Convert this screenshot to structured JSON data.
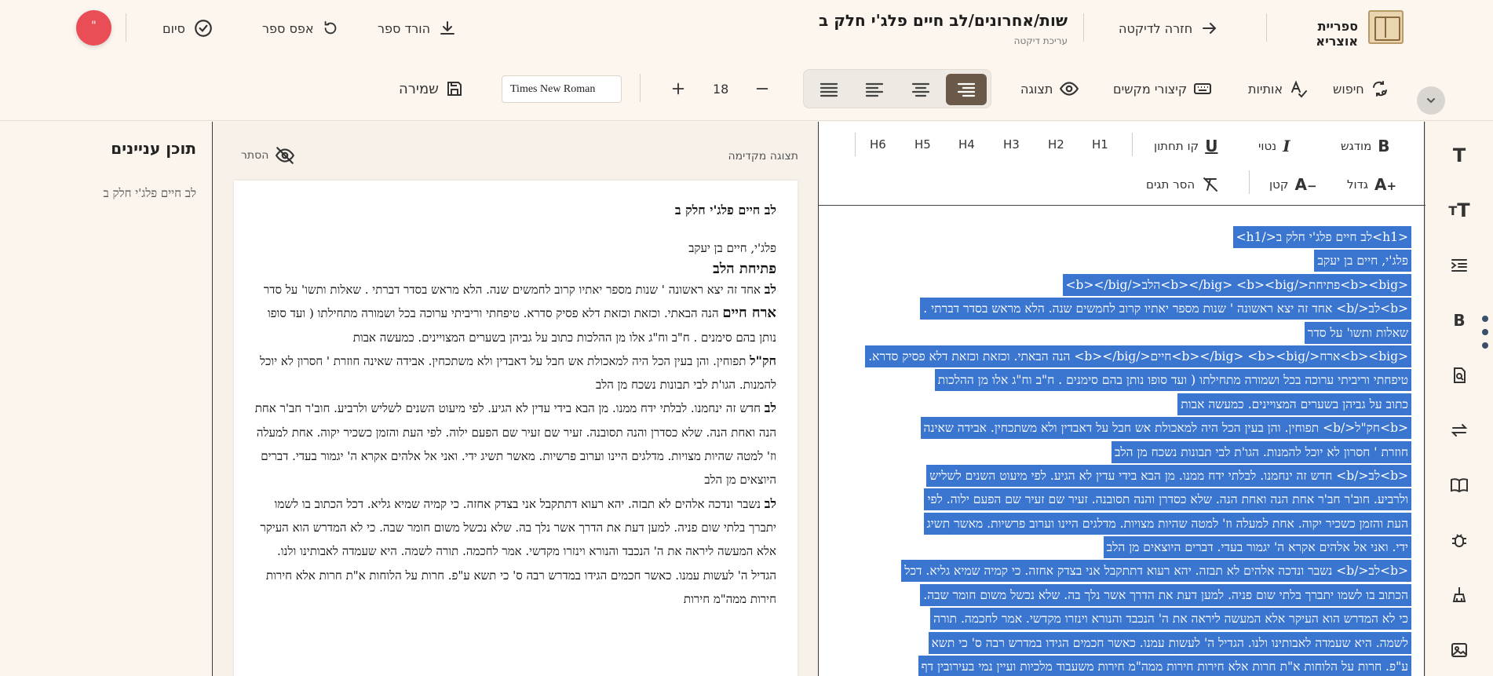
{
  "header": {
    "app_name": "ספריית אוצריא",
    "back_label": "חזרה לדיקטה",
    "title": "שות/אחרונים/לב חיים פלג'י חלק ב",
    "subtitle": "עריכת דיקטה",
    "download_label": "הורד ספר",
    "reset_label": "אפס ספר",
    "finish_label": "סיום",
    "avatar_text": "\""
  },
  "toolbar": {
    "search_label": "חיפוש",
    "letters_label": "אותיות",
    "shortcuts_label": "קיצורי מקשים",
    "view_label": "תצוגה",
    "font_size": "18",
    "font_family": "Times New Roman",
    "save_label": "שמירה"
  },
  "editor": {
    "bold_label": "מודגש",
    "italic_label": "נטוי",
    "underline_label": "קו תחתון",
    "headings": [
      "H1",
      "H2",
      "H3",
      "H4",
      "H5",
      "H6"
    ],
    "big_label": "גדול",
    "small_label": "קטן",
    "remove_tags_label": "הסר תגים",
    "lines": [
      "<h1>לב חיים פלג'י חלק ב</h1>",
      "פלג'י, חיים בן יעקב",
      "<b><big>פתיחת</b></big> <b><big>הלב</b></big>",
      "<b>לב</b> אחד זה יצא ראשונה ' שנות מספר יאתיו קרוב לחמשים שנה. הלא מראש בסדר דברתי .",
      "שאלות ותשו' על סדר",
      "<b><big>ארח</b></big> <b><big>חיים</b></big> הנה הבאתי. וכזאת וכזאת דלא פסיק סדרא.",
      "טיפחתי וריביתי ערוכה בכל ושמורה מתחילתו ( ועד סופו נותן בהם סימנים . ח\"ב וח\"ג אלו מן ההלכות",
      "כתוב על גביהן בשערים המצויינים. כמעשה אבות",
      "<b>חק\"ל</b> תפוחין. והן בעין הכל היה למאכולת אש חבל על דאבדין ולא משתכחין. אבידה שאינה",
      "חוזרת ' חסרון לא יוכל להמנות. הגו'ת לבי תבונות נשכח מן הלב",
      "<b>לב</b> חדש זה ינחמנו. לבלתי ידח ממנו. מן הבא בידי עדין לא הגיע. לפי מיעוט השנים לשליש",
      "ולרביע. חוב'ר חב'ר אחת הנה ואחת הנה. שלא כסדרן והנה תסובנה. זעיר שם זעיר שם הפעם ילוה. לפי",
      "העת והזמן כשכיר יקוה. אחת למעלה וז' למטה שהיות מצויות. מדלגים היינו וערוב פרשיות. מאשר תשיג",
      "ידי. ואני אל אלהים אקרא ה' יגמור בעדי. דברים היוצאים מן הלב",
      "<b>לב</b> נשבר ונדכה אלהים לא תבזה. יהא רעוא דתתקבל אני בצדק אחזה. כי קמיה שמיא גליא. דכל",
      "הכתוב בו לשמו יתברך בלתי שום פניה. למען דעת את הדרך אשר נלך בה. שלא נכשל משום חומר שבה.",
      "כי לא המדרש הוא העיקר אלא המעשה ליראה את ה' הנכבד והנורא וינזרו מקדשי. אמר לחכמה. תורה",
      "לשמה. היא שעמדה לאבותינו ולנו. הגדיל ה' לעשות עמנו. כאשר חכמים הגידו במדרש רבה ס' כי תשא",
      "ע\"פ. חרות על הלוחות א\"ת חרות אלא חירות חירות ממה\"מ חירות משעבוד מלכיות ועיין נמי בעירובין דף"
    ]
  },
  "preview": {
    "label": "תצוגה מקדימה",
    "hide_label": "הסתר",
    "title": "לב חיים פלג'י חלק ב",
    "author": "פלג'י, חיים בן יעקב",
    "section_heading": "פתיחת הלב",
    "paragraphs": [
      {
        "lead": "לב",
        "text": " אחד זה יצא ראשונה ' שנות מספר יאתיו קרוב לחמשים שנה. הלא מראש בסדר דברתי . שאלות ותשו' על סדר"
      },
      {
        "lead": "ארח חיים",
        "text": " הנה הבאתי. וכזאת וכזאת דלא פסיק סדרא. טיפחתי וריביתי ערוכה בכל ושמורה מתחילתו ( ועד סופו נותן בהם סימנים . ח\"ב וח\"ג אלו מן ההלכות כתוב על גביהן בשערים המצויינים. כמעשה אבות"
      },
      {
        "lead": "חק\"ל",
        "text": " תפוחין. והן בעין הכל היה למאכולת אש חבל על דאבדין ולא משתכחין. אבידה שאינה חוזרת ' חסרון לא יוכל להמנות. הגו'ת לבי תבונות נשכח מן הלב"
      },
      {
        "lead": "לב",
        "text": " חדש זה ינחמנו. לבלתי ידח ממנו. מן הבא בידי עדין לא הגיע. לפי מיעוט השנים לשליש ולרביע. חוב'ר חב'ר אחת הנה ואחת הנה. שלא כסדרן והנה תסובנה. זעיר שם זעיר שם הפעם ילוה. לפי העת והזמן כשכיר יקוה. אחת למעלה וז' למטה שהיות מצויות. מדלגים היינו וערוב פרשיות. מאשר תשיג ידי. ואני אל אלהים אקרא ה' יגמור בעדי. דברים היוצאים מן הלב"
      },
      {
        "lead": "לב",
        "text": " נשבר ונדכה אלהים לא תבזה. יהא רעוא דתתקבל אני בצדק אחזה. כי קמיה שמיא גליא. דכל הכתוב בו לשמו יתברך בלתי שום פניה. למען דעת את הדרך אשר נלך בה. שלא נכשל משום חומר שבה. כי לא המדרש הוא העיקר אלא המעשה ליראה את ה' הנכבד והנורא וינזרו מקדשי. אמר לחכמה. תורה לשמה. היא שעמדה לאבותינו ולנו. הגדיל ה' לעשות עמנו. כאשר חכמים הגידו במדרש רבה ס' כי תשא ע\"פ. חרות על הלוחות א\"ת חרות אלא חירות חירות ממה\"מ חירות"
      }
    ]
  },
  "toc": {
    "title": "תוכן עניינים",
    "items": [
      "לב חיים פלג'י חלק ב"
    ]
  },
  "colors": {
    "accent_dark": "#6a5848",
    "selection": "#3a75d0",
    "danger": "#e94d56",
    "background": "#fbf5ee"
  }
}
